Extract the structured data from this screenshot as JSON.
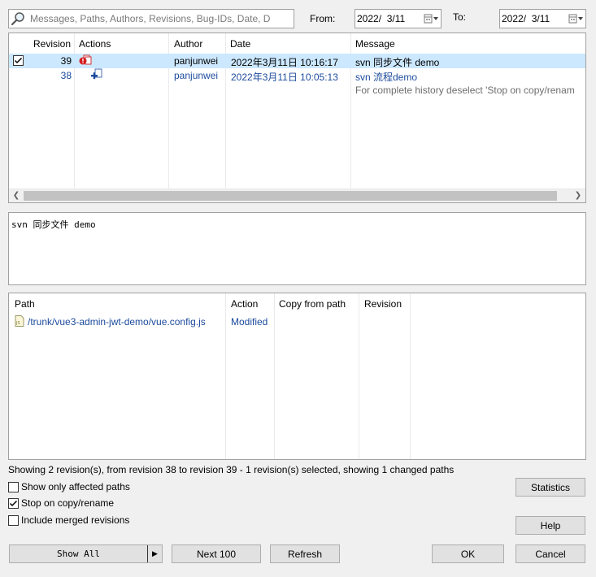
{
  "filter": {
    "search_placeholder": "Messages, Paths, Authors, Revisions, Bug-IDs, Date, D",
    "from_label": "From:",
    "from_value": "2022/  3/11",
    "to_label": "To:",
    "to_value": "2022/  3/11"
  },
  "revisions": {
    "headers": [
      "Revision",
      "Actions",
      "Author",
      "Date",
      "Message"
    ],
    "rows": [
      {
        "revision": "39",
        "author": "panjunwei",
        "date": "2022年3月11日 10:16:17",
        "message": "svn 同步文件 demo",
        "selected": true,
        "checked": true
      },
      {
        "revision": "38",
        "author": "panjunwei",
        "date": "2022年3月11日 10:05:13",
        "message": "svn 流程demo",
        "selected": false,
        "checked": false
      }
    ],
    "hint": "For complete history deselect 'Stop on copy/renam"
  },
  "message_text": "svn 同步文件 demo",
  "paths": {
    "headers": [
      "Path",
      "Action",
      "Copy from path",
      "Revision"
    ],
    "rows": [
      {
        "path": "/trunk/vue3-admin-jwt-demo/vue.config.js",
        "action": "Modified",
        "copy_from": "",
        "revision": ""
      }
    ]
  },
  "status_text": "Showing 2 revision(s), from revision 38 to revision 39 - 1 revision(s) selected, showing 1 changed paths",
  "options": {
    "affected_paths": {
      "label": "Show only affected paths",
      "checked": false
    },
    "stop_on_copy": {
      "label": "Stop on copy/rename",
      "checked": true
    },
    "include_merged": {
      "label": "Include merged revisions",
      "checked": false
    }
  },
  "buttons": {
    "statistics": "Statistics",
    "help": "Help",
    "show_all": "Show All",
    "next_100": "Next 100",
    "refresh": "Refresh",
    "ok": "OK",
    "cancel": "Cancel"
  },
  "colors": {
    "selection": "#cce8ff",
    "link_blue": "#1c4a9c",
    "error_red": "#d41e1e"
  }
}
